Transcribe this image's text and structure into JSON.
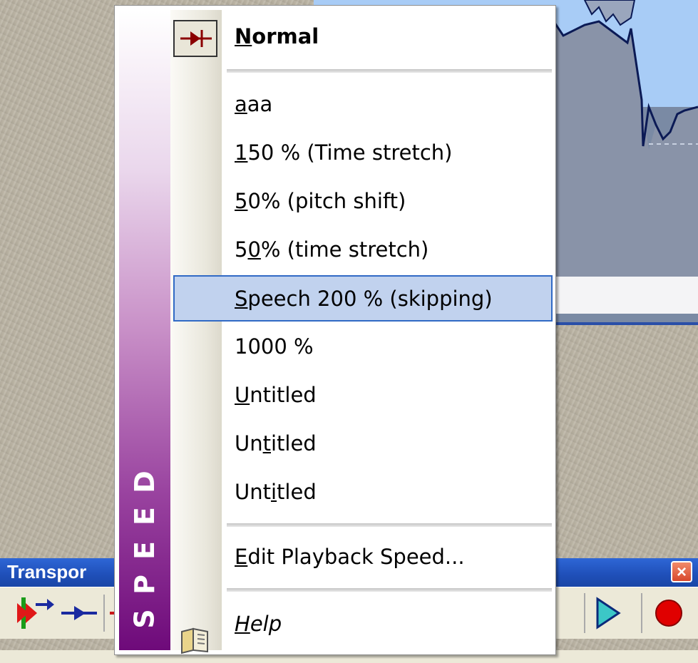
{
  "menu": {
    "side_label": [
      "S",
      "P",
      "E",
      "E",
      "D"
    ],
    "items": [
      {
        "text": "Normal",
        "u": 0
      },
      {
        "text": "aaa",
        "u": 0
      },
      {
        "text": "150 % (Time stretch)",
        "u": 0
      },
      {
        "text": "50% (pitch shift)",
        "u": 0
      },
      {
        "text": "50% (time stretch)",
        "u": 1
      },
      {
        "text": "Speech 200 % (skipping)",
        "u": 0
      },
      {
        "text": "1000 %",
        "u": -1
      },
      {
        "text": "Untitled",
        "u": 0
      },
      {
        "text": "Untitled",
        "u": 2
      },
      {
        "text": "Untitled",
        "u": 3
      },
      {
        "text": "Edit Playback Speed...",
        "u": 0
      },
      {
        "text": "Help",
        "u": 0
      }
    ]
  },
  "transport": {
    "title": "Transpor",
    "close_glyph": "×"
  },
  "colors": {
    "highlight_bg": "#c1d2ee",
    "highlight_border": "#316ac5",
    "band_bottom": "#6e0a7a",
    "titlebar": "#2458c6"
  },
  "icons": [
    "normal-speed-icon",
    "help-book-icon",
    "close-icon",
    "play-icon",
    "record-icon"
  ]
}
